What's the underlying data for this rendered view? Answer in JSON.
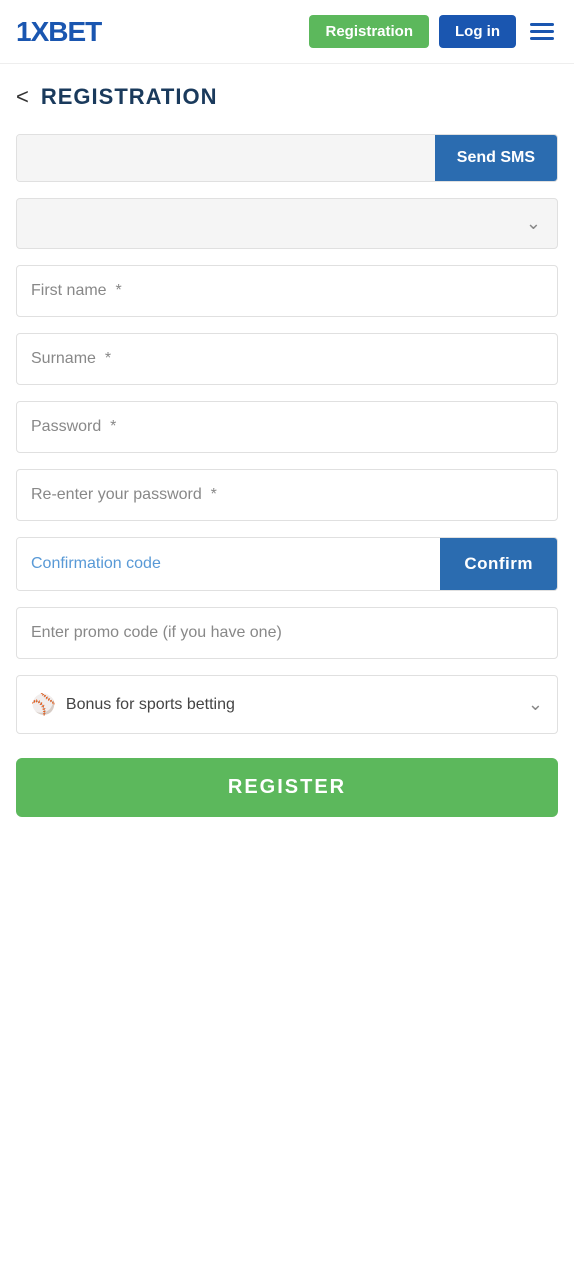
{
  "header": {
    "logo": "1XBET",
    "registration_label": "Registration",
    "login_label": "Log in"
  },
  "page": {
    "back_label": "<",
    "title": "REGISTRATION"
  },
  "form": {
    "phone_placeholder": "",
    "send_sms_label": "Send SMS",
    "dropdown_placeholder": "",
    "first_name_placeholder": "First name  *",
    "surname_placeholder": "Surname  *",
    "password_placeholder": "Password  *",
    "reenter_password_placeholder": "Re-enter your password  *",
    "confirmation_code_placeholder": "Confirmation code",
    "confirm_label": "Confirm",
    "promo_code_placeholder": "Enter promo code (if you have one)",
    "bonus_label": "Bonus for sports betting",
    "register_label": "REGISTER"
  }
}
